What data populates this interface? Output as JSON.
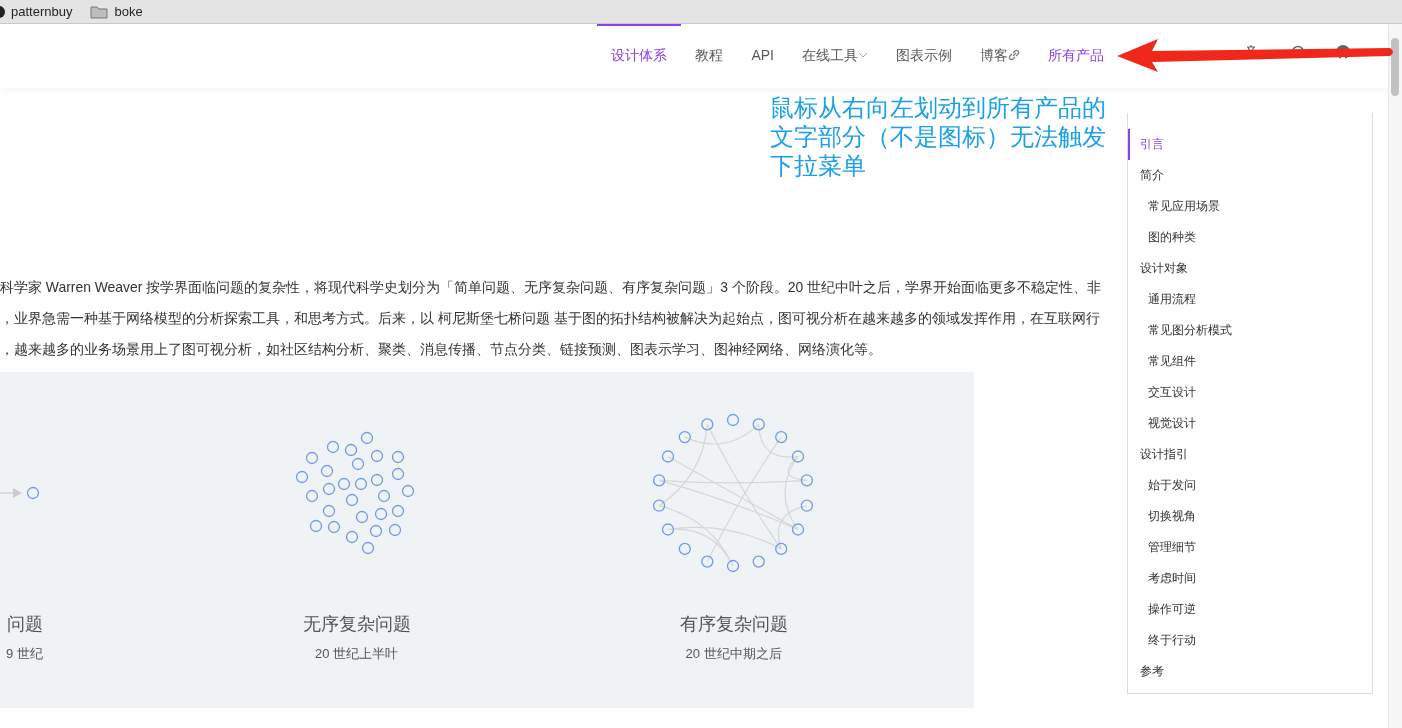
{
  "bookmarks": [
    {
      "label": "patternbuy",
      "kind": "site"
    },
    {
      "label": "boke",
      "kind": "folder"
    }
  ],
  "nav": {
    "items": [
      {
        "label": "设计体系",
        "kind": "plain",
        "selected": true,
        "highlighted": true
      },
      {
        "label": "教程",
        "kind": "plain",
        "selected": false,
        "highlighted": false
      },
      {
        "label": "API",
        "kind": "plain",
        "selected": false,
        "highlighted": false
      },
      {
        "label": "在线工具",
        "kind": "dropdown",
        "selected": false,
        "highlighted": false
      },
      {
        "label": "图表示例",
        "kind": "plain",
        "selected": false,
        "highlighted": false
      },
      {
        "label": "博客",
        "kind": "external",
        "selected": false,
        "highlighted": false
      },
      {
        "label": "所有产品",
        "kind": "plain",
        "selected": false,
        "highlighted": true
      }
    ]
  },
  "paragraph": {
    "lines": [
      "科学家 Warren Weaver 按学界面临问题的复杂性，将现代科学史划分为「简单问题、无序复杂问题、有序复杂问题」3 个阶段。20 世纪中叶之后，学界开始面临更多不稳定性、非",
      "，业界急需一种基于网络模型的分析探索工具，和思考方式。后来，以 柯尼斯堡七桥问题 基于图的拓扑结构被解决为起始点，图可视分析在越来越多的领域发挥作用，在互联网行",
      "，越来越多的业务场景用上了图可视分析，如社区结构分析、聚类、消息传播、节点分类、链接预测、图表示学习、图神经网络、网络演化等。"
    ]
  },
  "figure": {
    "stages": [
      {
        "kind": "simple",
        "title": "问题",
        "subtitle": "9 世纪"
      },
      {
        "kind": "disordered",
        "title": "无序复杂问题",
        "subtitle": "20 世纪上半叶"
      },
      {
        "kind": "ordered",
        "title": "有序复杂问题",
        "subtitle": "20 世纪中期之后"
      }
    ]
  },
  "toc": {
    "items": [
      {
        "label": "引言",
        "selected": true
      },
      {
        "label": "简介",
        "selected": false,
        "children": [
          {
            "label": "常见应用场景",
            "selected": false
          },
          {
            "label": "图的种类",
            "selected": false
          }
        ]
      },
      {
        "label": "设计对象",
        "selected": false,
        "children": [
          {
            "label": "通用流程",
            "selected": false
          },
          {
            "label": "常见图分析模式",
            "selected": false
          },
          {
            "label": "常见组件",
            "selected": false
          },
          {
            "label": "交互设计",
            "selected": false
          },
          {
            "label": "视觉设计",
            "selected": false
          }
        ]
      },
      {
        "label": "设计指引",
        "selected": false,
        "children": [
          {
            "label": "始于发问",
            "selected": false
          },
          {
            "label": "切换视角",
            "selected": false
          },
          {
            "label": "管理细节",
            "selected": false
          },
          {
            "label": "考虑时间",
            "selected": false
          },
          {
            "label": "操作可逆",
            "selected": false
          },
          {
            "label": "终于行动",
            "selected": false
          }
        ]
      },
      {
        "label": "参考",
        "selected": false
      }
    ]
  },
  "annotation": {
    "text": "鼠标从右向左划动到所有产品的文字部分（不是图标）无法触发下拉菜单"
  }
}
